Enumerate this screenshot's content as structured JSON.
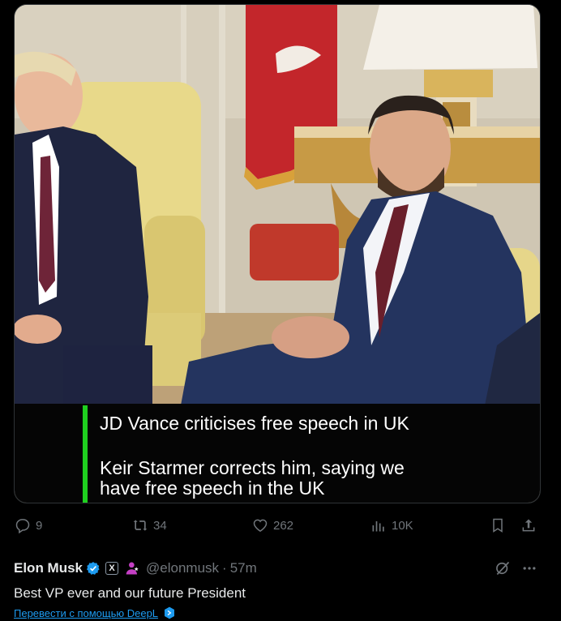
{
  "video": {
    "caption_headline": "JD Vance criticises free speech in UK",
    "caption_line_1": "Keir Starmer corrects him, saying we",
    "caption_line_2": "have free speech in the UK",
    "accent_color": "#1fd01f"
  },
  "actions": {
    "replies": "9",
    "reposts": "34",
    "likes": "262",
    "views": "10K"
  },
  "author": {
    "name": "Elon Musk",
    "handle": "@elonmusk",
    "separator": "·",
    "time": "57m",
    "verified_color": "#1d9bf0",
    "affiliate_badge": "X"
  },
  "tweet": {
    "text": "Best VP ever and our future President",
    "translate_label": "Перевести с помощью DeepL"
  },
  "icons": [
    "reply-icon",
    "repost-icon",
    "like-icon",
    "views-icon",
    "bookmark-icon",
    "share-icon",
    "verified-icon",
    "grok-icon",
    "more-icon",
    "deepl-icon"
  ]
}
